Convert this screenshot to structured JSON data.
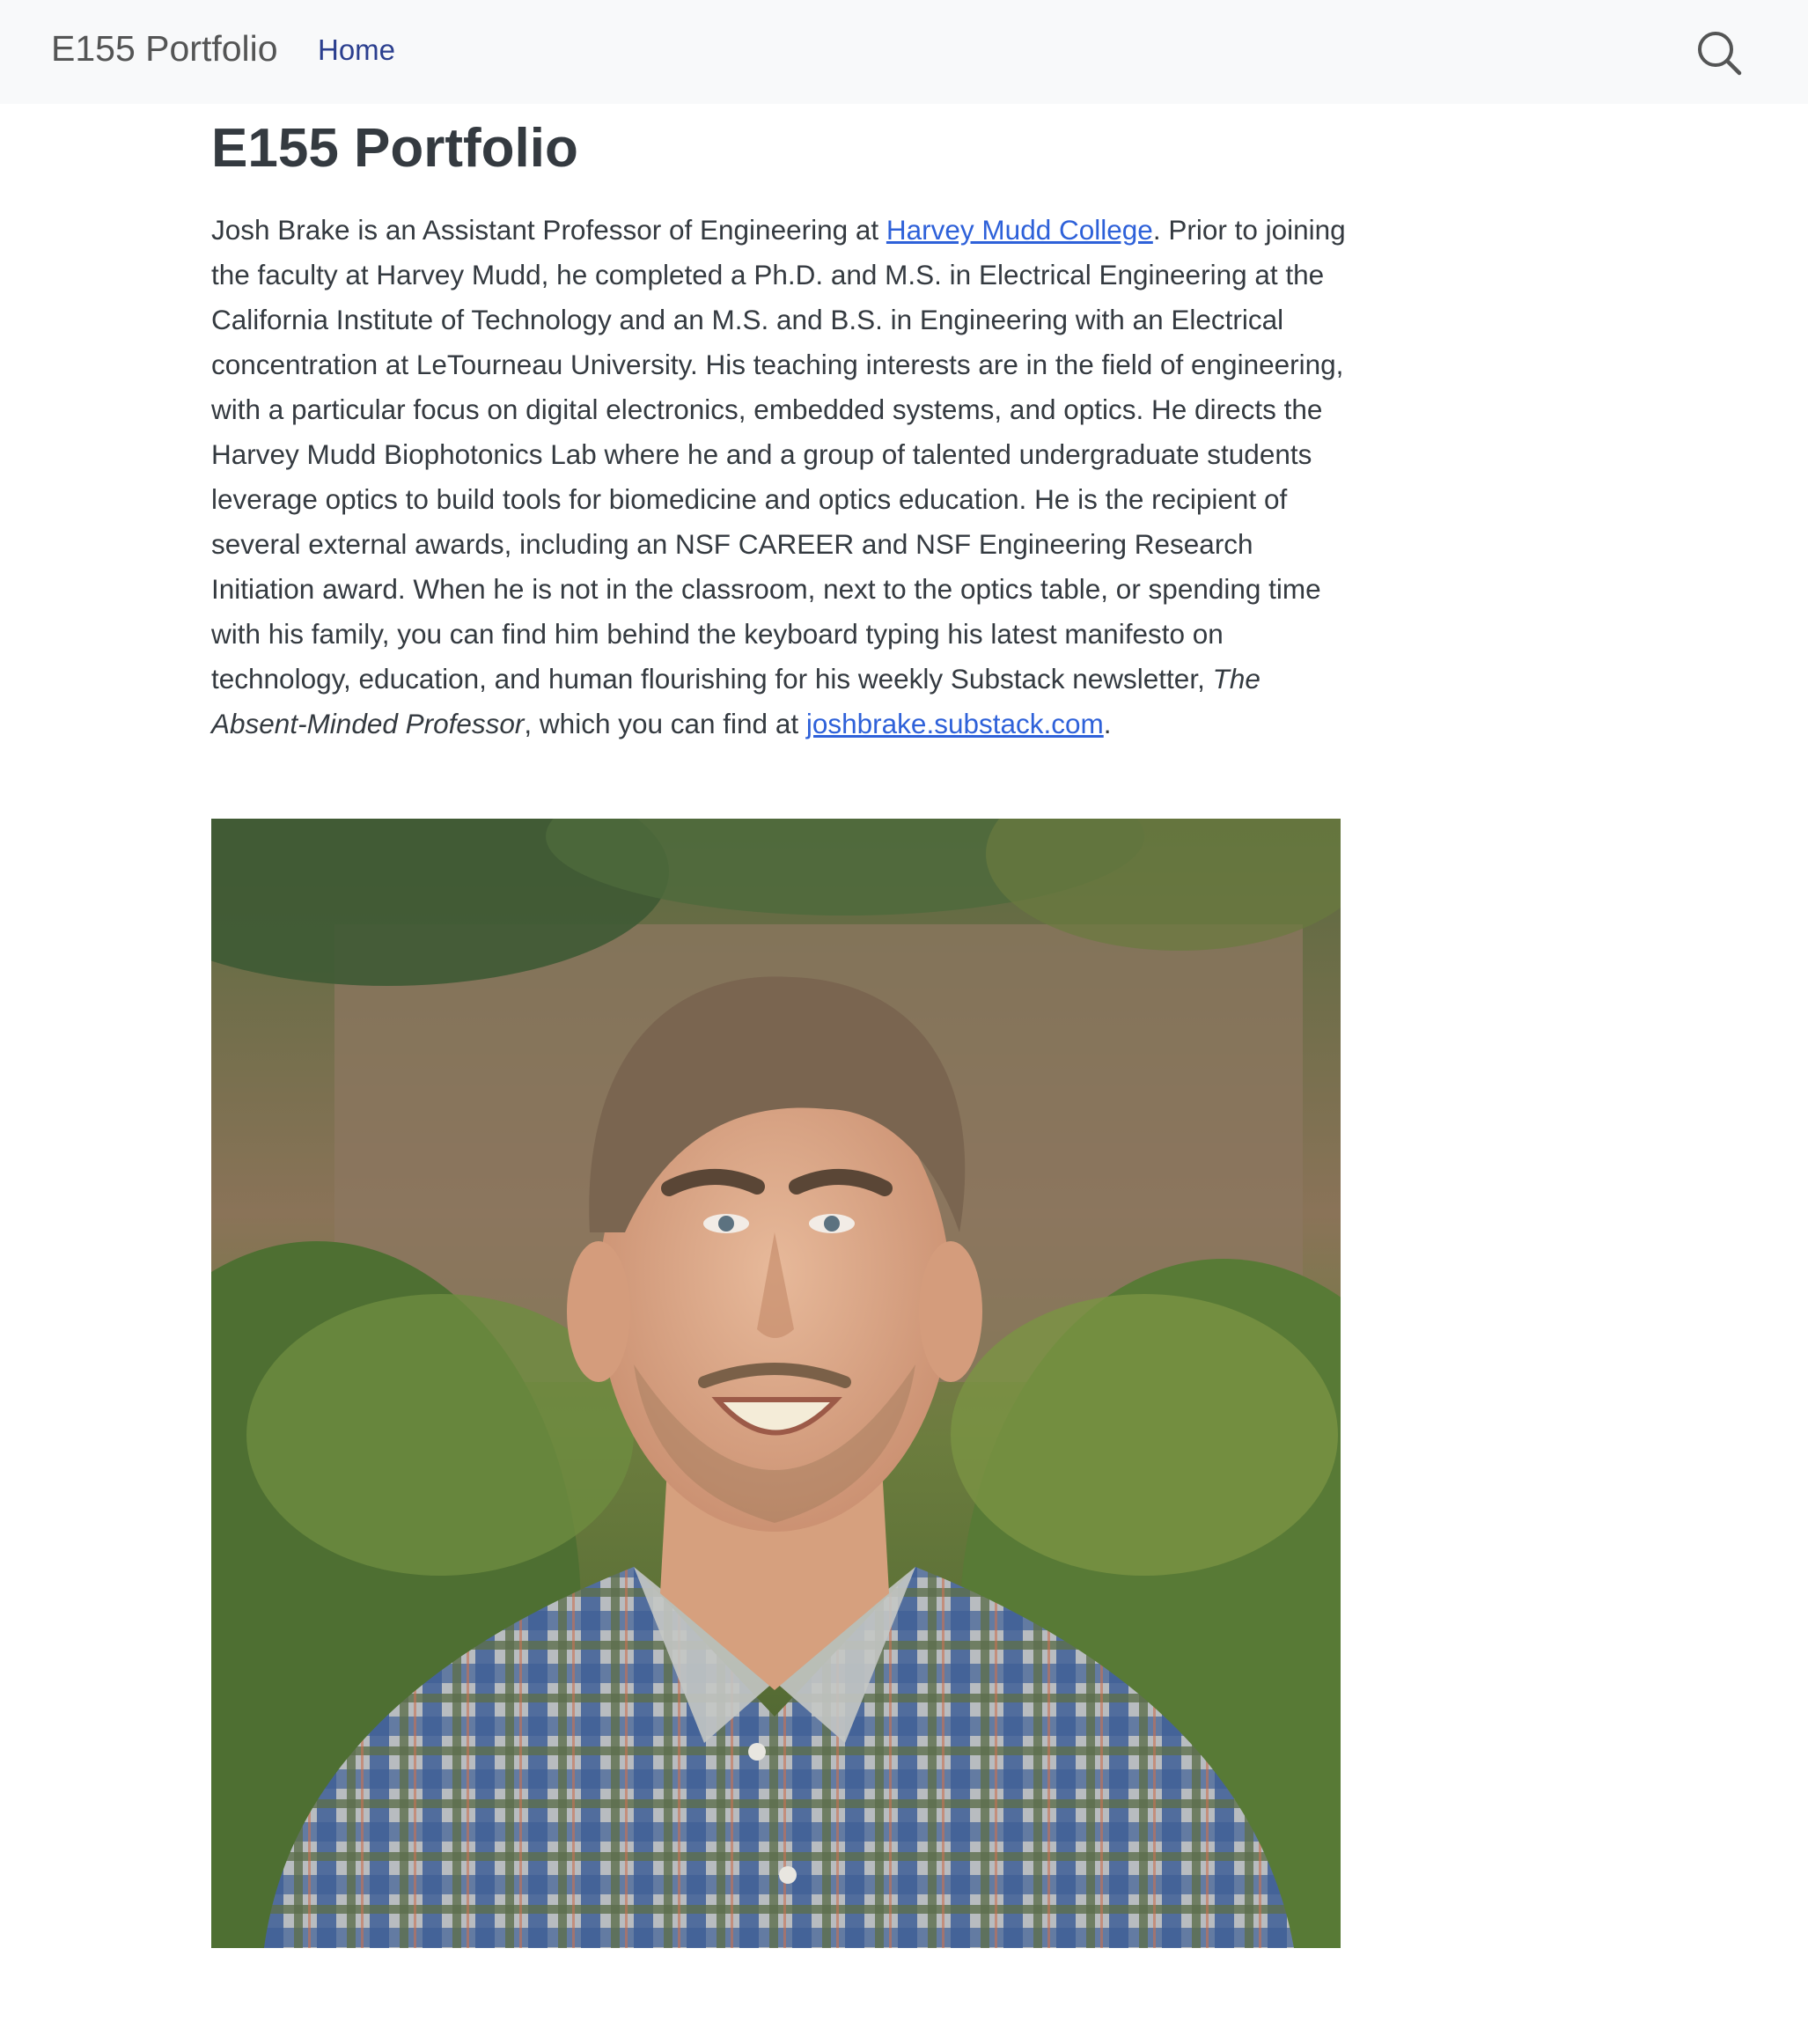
{
  "navbar": {
    "brand": "E155 Portfolio",
    "links": [
      {
        "label": "Home"
      }
    ],
    "search_icon": "search-icon"
  },
  "main": {
    "title": "E155 Portfolio",
    "bio": {
      "part1": "Josh Brake is an Assistant Professor of Engineering at ",
      "link1": "Harvey Mudd College",
      "part2": ". Prior to joining the faculty at Harvey Mudd, he completed a Ph.D. and M.S. in Electrical Engineering at the California Institute of Technology and an M.S. and B.S. in Engineering with an Electrical concentration at LeTourneau University. His teaching interests are in the field of engineering, with a particular focus on digital electronics, embedded systems, and optics. He directs the Harvey Mudd Biophotonics Lab where he and a group of talented undergraduate students leverage optics to build tools for biomedicine and optics education. He is the recipient of several external awards, including an NSF CAREER and NSF Engineering Research Initiation award. When he is not in the classroom, next to the optics table, or spending time with his family, you can find him behind the keyboard typing his latest manifesto on technology, education, and human flourishing for his weekly Substack newsletter, ",
      "newsletter": "The Absent-Minded Professor",
      "part3": ", which you can find at ",
      "link2": "joshbrake.substack.com",
      "part4": "."
    },
    "portrait": "portrait-photo"
  },
  "colors": {
    "navbar_bg": "#f8f9fa",
    "link": "#2e61d9",
    "nav_link": "#2b3f8f",
    "text": "#343a40"
  }
}
